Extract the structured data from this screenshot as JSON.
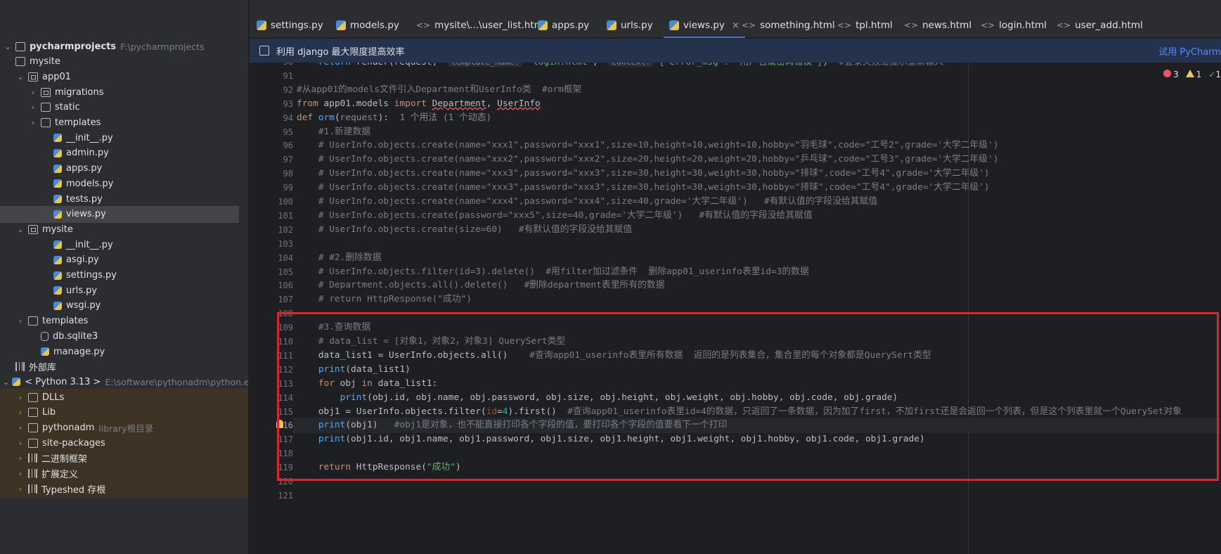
{
  "project": {
    "rows": [
      {
        "label": "pycharmprojects",
        "hint": "F:\\pycharmprojects",
        "type": "folder",
        "indent": 0,
        "chev": "⌄",
        "bold": true
      },
      {
        "label": "mysite",
        "type": "folder",
        "indent": 0,
        "chev": ""
      },
      {
        "label": "app01",
        "type": "folder-mod",
        "indent": 1,
        "chev": "⌄"
      },
      {
        "label": "migrations",
        "type": "folder-mod",
        "indent": 2,
        "chev": "›"
      },
      {
        "label": "static",
        "type": "folder",
        "indent": 2,
        "chev": "›"
      },
      {
        "label": "templates",
        "type": "folder",
        "indent": 2,
        "chev": "›"
      },
      {
        "label": "__init__.py",
        "type": "py",
        "indent": 3,
        "chev": ""
      },
      {
        "label": "admin.py",
        "type": "py",
        "indent": 3,
        "chev": ""
      },
      {
        "label": "apps.py",
        "type": "py",
        "indent": 3,
        "chev": ""
      },
      {
        "label": "models.py",
        "type": "py",
        "indent": 3,
        "chev": ""
      },
      {
        "label": "tests.py",
        "type": "py",
        "indent": 3,
        "chev": ""
      },
      {
        "label": "views.py",
        "type": "py",
        "indent": 3,
        "chev": "",
        "selected": true
      },
      {
        "label": "mysite",
        "type": "folder-mod",
        "indent": 1,
        "chev": "⌄"
      },
      {
        "label": "__init__.py",
        "type": "py",
        "indent": 3,
        "chev": ""
      },
      {
        "label": "asgi.py",
        "type": "py",
        "indent": 3,
        "chev": ""
      },
      {
        "label": "settings.py",
        "type": "py",
        "indent": 3,
        "chev": ""
      },
      {
        "label": "urls.py",
        "type": "py",
        "indent": 3,
        "chev": ""
      },
      {
        "label": "wsgi.py",
        "type": "py",
        "indent": 3,
        "chev": ""
      },
      {
        "label": "templates",
        "type": "folder",
        "indent": 1,
        "chev": "›"
      },
      {
        "label": "db.sqlite3",
        "type": "db",
        "indent": 2,
        "chev": ""
      },
      {
        "label": "manage.py",
        "type": "py",
        "indent": 2,
        "chev": ""
      },
      {
        "label": "外部库",
        "type": "libroot",
        "indent": 0,
        "chev": ""
      },
      {
        "label": "< Python 3.13 >",
        "hint": "E:\\software\\pythonadm\\python.exe",
        "type": "py",
        "indent": 0,
        "chev": "⌄"
      },
      {
        "label": "DLLs",
        "type": "folder",
        "indent": 1,
        "chev": "›",
        "lib": true
      },
      {
        "label": "Lib",
        "type": "folder",
        "indent": 1,
        "chev": "›",
        "lib": true
      },
      {
        "label": "pythonadm",
        "hint": "library根目录",
        "type": "folder",
        "indent": 1,
        "chev": "›",
        "lib": true
      },
      {
        "label": "site-packages",
        "type": "folder",
        "indent": 1,
        "chev": "›",
        "lib": true
      },
      {
        "label": "二进制框架",
        "type": "libico",
        "indent": 1,
        "chev": "›",
        "lib": true
      },
      {
        "label": "扩展定义",
        "type": "libico",
        "indent": 1,
        "chev": "›",
        "lib": true
      },
      {
        "label": "Typeshed 存根",
        "type": "libico",
        "indent": 1,
        "chev": "›",
        "lib": true
      }
    ]
  },
  "tabs": [
    {
      "label": "settings.py",
      "kind": "py"
    },
    {
      "label": "models.py",
      "kind": "py"
    },
    {
      "label": "mysite\\...\\user_list.html",
      "kind": "html"
    },
    {
      "label": "apps.py",
      "kind": "py"
    },
    {
      "label": "urls.py",
      "kind": "py"
    },
    {
      "label": "views.py",
      "kind": "py",
      "active": true
    },
    {
      "label": "something.html",
      "kind": "html"
    },
    {
      "label": "tpl.html",
      "kind": "html"
    },
    {
      "label": "news.html",
      "kind": "html"
    },
    {
      "label": "login.html",
      "kind": "html"
    },
    {
      "label": "user_add.html",
      "kind": "html"
    }
  ],
  "banner": {
    "text": "利用 django 最大限度提高效率",
    "link": "试用 PyCharm"
  },
  "inspections": {
    "errors": "3",
    "warnings": "1",
    "ok": "1"
  },
  "current_line": "116",
  "code": [
    {
      "n": "90",
      "segs": [
        [
          "",
          "    "
        ],
        [
          "fn",
          "return "
        ],
        [
          "",
          "render(request,  "
        ],
        [
          "hint",
          "template_name:"
        ],
        [
          "str",
          " \"login.html\""
        ],
        [
          "",
          ",  "
        ],
        [
          "hint",
          "context:"
        ],
        [
          "str",
          " {\"error_msg\": \"用户名或密码错误\"}"
        ],
        [
          "",
          ")  "
        ],
        [
          "cmt",
          "#登录失败给提示重新输入"
        ]
      ]
    },
    {
      "n": "91",
      "segs": []
    },
    {
      "n": "92",
      "segs": [
        [
          "cmt",
          "#从app01的models文件引入Department和UserInfo类  #orm框架"
        ]
      ]
    },
    {
      "n": "93",
      "segs": [
        [
          "kw",
          "from "
        ],
        [
          "",
          "app01.models "
        ],
        [
          "kw",
          "import "
        ],
        [
          "ulf",
          "Department"
        ],
        [
          "",
          ", "
        ],
        [
          "ulf",
          "UserInfo"
        ]
      ]
    },
    {
      "n": "94",
      "segs": [
        [
          "kw",
          "def "
        ],
        [
          "fn",
          "orm"
        ],
        [
          "",
          "("
        ],
        [
          "grey",
          "request"
        ],
        [
          "",
          "):  "
        ],
        [
          "grey",
          "1 个用法 (1 个动态)"
        ]
      ]
    },
    {
      "n": "95",
      "segs": [
        [
          "cmt",
          "    #1.新建数据"
        ]
      ]
    },
    {
      "n": "96",
      "segs": [
        [
          "cmt",
          "    # UserInfo.objects.create(name=\"xxx1\",password=\"xxx1\",size=10,height=10,weight=10,hobby=\"羽毛球\",code=\"工号2\",grade='大学二年级')"
        ]
      ]
    },
    {
      "n": "97",
      "segs": [
        [
          "cmt",
          "    # UserInfo.objects.create(name=\"xxx2\",password=\"xxx2\",size=20,height=20,weight=20,hobby=\"乒乓球\",code=\"工号3\",grade='大学二年级')"
        ]
      ]
    },
    {
      "n": "98",
      "segs": [
        [
          "cmt",
          "    # UserInfo.objects.create(name=\"xxx3\",password=\"xxx3\",size=30,height=30,weight=30,hobby=\"排球\",code=\"工号4\",grade='大学二年级')"
        ]
      ]
    },
    {
      "n": "99",
      "segs": [
        [
          "cmt",
          "    # UserInfo.objects.create(name=\"xxx3\",password=\"xxx3\",size=30,height=30,weight=30,hobby=\"排球\",code=\"工号4\",grade='大学二年级')"
        ]
      ]
    },
    {
      "n": "100",
      "segs": [
        [
          "cmt",
          "    # UserInfo.objects.create(name=\"xxx4\",password=\"xxx4\",size=40,grade='大学二年级')   #有默认值的字段没给其赋值"
        ]
      ]
    },
    {
      "n": "101",
      "segs": [
        [
          "cmt",
          "    # UserInfo.objects.create(password=\"xxx5\",size=40,grade='大学二年级')   #有默认值的字段没给其赋值"
        ]
      ]
    },
    {
      "n": "102",
      "segs": [
        [
          "cmt",
          "    # UserInfo.objects.create(size=60)   #有默认值的字段没给其赋值"
        ]
      ]
    },
    {
      "n": "103",
      "segs": []
    },
    {
      "n": "104",
      "segs": [
        [
          "cmt",
          "    # #2.删除数据"
        ]
      ]
    },
    {
      "n": "105",
      "segs": [
        [
          "cmt",
          "    # UserInfo.objects.filter(id=3).delete()  #用filter加过滤条件  删除app01_userinfo表里id=3的数据"
        ]
      ]
    },
    {
      "n": "106",
      "segs": [
        [
          "cmt",
          "    # Department.objects.all().delete()   #删除department表里所有的数据"
        ]
      ]
    },
    {
      "n": "107",
      "segs": [
        [
          "cmt",
          "    # return HttpResponse(\"成功\")"
        ]
      ]
    },
    {
      "n": "108",
      "segs": []
    },
    {
      "n": "109",
      "segs": [
        [
          "cmt",
          "    #3.查询数据"
        ]
      ]
    },
    {
      "n": "110",
      "segs": [
        [
          "cmt",
          "    # data_list = [对象1，对象2，对象3] QuerySert类型"
        ]
      ]
    },
    {
      "n": "111",
      "segs": [
        [
          "",
          "    data_list1 = UserInfo.objects.all()    "
        ],
        [
          "cmt",
          "#查询app01_userinfo表里所有数据  返回的是列表集合，集合里的每个对象都是QuerySert类型"
        ]
      ]
    },
    {
      "n": "112",
      "segs": [
        [
          "fn",
          "    print"
        ],
        [
          "",
          "(data_list1)"
        ]
      ]
    },
    {
      "n": "113",
      "segs": [
        [
          "kw",
          "    for "
        ],
        [
          "",
          "obj "
        ],
        [
          "kw",
          "in "
        ],
        [
          "",
          "data_list1:"
        ]
      ]
    },
    {
      "n": "114",
      "segs": [
        [
          "fn",
          "        print"
        ],
        [
          "",
          "(obj.id, obj.name, obj.password, obj.size, obj.height, obj.weight, obj.hobby, obj.code, obj.grade)"
        ]
      ]
    },
    {
      "n": "115",
      "segs": [
        [
          "",
          "    obj1 = UserInfo.objects.filter("
        ],
        [
          "pn",
          "id"
        ],
        [
          "",
          "="
        ],
        [
          "num",
          "4"
        ],
        [
          "",
          ").first()  "
        ],
        [
          "cmt",
          "#查询app01_userinfo表里id=4的数据，只返回了一条数据，因为加了first，不加first还是会返回一个列表，但是这个列表里就一个QuerySet对象"
        ]
      ]
    },
    {
      "n": "116",
      "segs": [
        [
          "fn",
          "    print"
        ],
        [
          "",
          "(obj1)   "
        ],
        [
          "cmt",
          "#obj1是对象，也不能直接打印各个字段的值，要打印各个字段的值要看下一个打印"
        ]
      ]
    },
    {
      "n": "117",
      "segs": [
        [
          "fn",
          "    print"
        ],
        [
          "",
          "(obj1.id, obj1.name, obj1.password, obj1.size, obj1.height, obj1.weight, obj1.hobby, obj1.code, obj1.grade)"
        ]
      ]
    },
    {
      "n": "118",
      "segs": []
    },
    {
      "n": "119",
      "segs": [
        [
          "kw",
          "    return "
        ],
        [
          "",
          "HttpResponse("
        ],
        [
          "str",
          "\"成功\""
        ],
        [
          "",
          ")"
        ]
      ]
    },
    {
      "n": "120",
      "segs": []
    },
    {
      "n": "121",
      "segs": []
    }
  ]
}
